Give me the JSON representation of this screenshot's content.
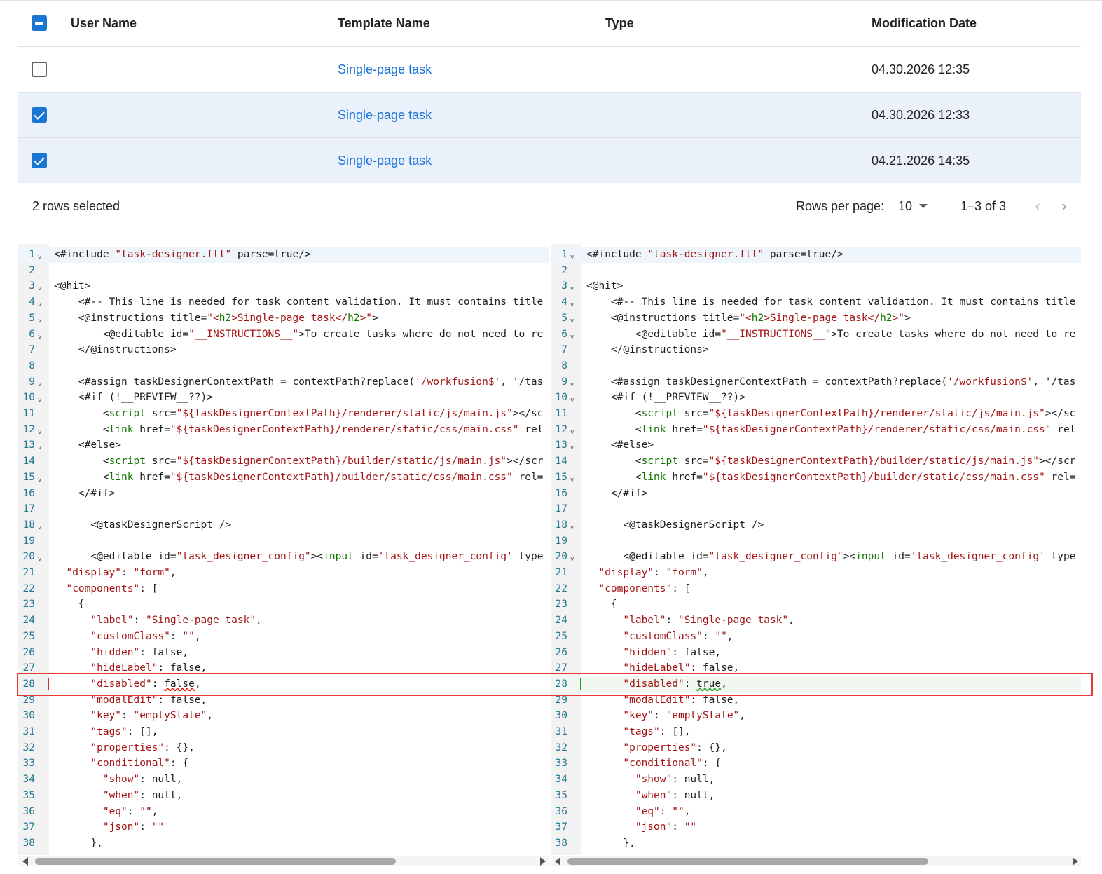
{
  "table": {
    "headers": [
      "User Name",
      "Template Name",
      "Type",
      "Modification Date"
    ],
    "rows": [
      {
        "user": "",
        "template": "Single-page task",
        "type": "",
        "date": "04.30.2026 12:35",
        "selected": false
      },
      {
        "user": "",
        "template": "Single-page task",
        "type": "",
        "date": "04.30.2026 12:33",
        "selected": true
      },
      {
        "user": "",
        "template": "Single-page task",
        "type": "",
        "date": "04.21.2026 14:35",
        "selected": true
      }
    ]
  },
  "footer": {
    "selected_text": "2 rows selected",
    "rows_per_page_label": "Rows per page:",
    "rows_per_page_value": "10",
    "range_text": "1–3 of 3"
  },
  "colors": {
    "accent": "#1976d2",
    "link": "#1a73d9",
    "removed": "#d32f2f",
    "added": "#2e9e2e"
  },
  "diff": {
    "changed_line": 28,
    "left_lines": [
      {
        "n": "1",
        "fold": true,
        "code": "<#include \"task-designer.ftl\" parse=true/>"
      },
      {
        "n": "2",
        "fold": false,
        "code": ""
      },
      {
        "n": "3",
        "fold": true,
        "code": "<@hit>"
      },
      {
        "n": "4",
        "fold": true,
        "code": "    <#-- This line is needed for task content validation. It must contains title"
      },
      {
        "n": "5",
        "fold": true,
        "code": "    <@instructions title=\"<h2>Single-page task</h2>\">"
      },
      {
        "n": "6",
        "fold": true,
        "code": "        <@editable id=\"__INSTRUCTIONS__\">To create tasks where do not need to re"
      },
      {
        "n": "7",
        "fold": false,
        "code": "    </@instructions>"
      },
      {
        "n": "8",
        "fold": false,
        "code": ""
      },
      {
        "n": "9",
        "fold": true,
        "code": "    <#assign taskDesignerContextPath = contextPath?replace('/workfusion$', '/tas"
      },
      {
        "n": "10",
        "fold": true,
        "code": "    <#if (!__PREVIEW__??)>"
      },
      {
        "n": "11",
        "fold": false,
        "code": "        <script src=\"${taskDesignerContextPath}/renderer/static/js/main.js\"></sc"
      },
      {
        "n": "12",
        "fold": true,
        "code": "        <link href=\"${taskDesignerContextPath}/renderer/static/css/main.css\" rel"
      },
      {
        "n": "13",
        "fold": true,
        "code": "    <#else>"
      },
      {
        "n": "14",
        "fold": false,
        "code": "        <script src=\"${taskDesignerContextPath}/builder/static/js/main.js\"></scr"
      },
      {
        "n": "15",
        "fold": true,
        "code": "        <link href=\"${taskDesignerContextPath}/builder/static/css/main.css\" rel="
      },
      {
        "n": "16",
        "fold": false,
        "code": "    </#if>"
      },
      {
        "n": "17",
        "fold": false,
        "code": ""
      },
      {
        "n": "18",
        "fold": true,
        "code": "      <@taskDesignerScript />"
      },
      {
        "n": "19",
        "fold": false,
        "code": ""
      },
      {
        "n": "20",
        "fold": true,
        "code": "      <@editable id=\"task_designer_config\"><input id='task_designer_config' type"
      },
      {
        "n": "21",
        "fold": false,
        "code": "  \"display\": \"form\","
      },
      {
        "n": "22",
        "fold": false,
        "code": "  \"components\": ["
      },
      {
        "n": "23",
        "fold": false,
        "code": "    {"
      },
      {
        "n": "24",
        "fold": false,
        "code": "      \"label\": \"Single-page task\","
      },
      {
        "n": "25",
        "fold": false,
        "code": "      \"customClass\": \"\","
      },
      {
        "n": "26",
        "fold": false,
        "code": "      \"hidden\": false,"
      },
      {
        "n": "27",
        "fold": false,
        "code": "      \"hideLabel\": false,"
      },
      {
        "n": "28",
        "fold": false,
        "code": "      \"disabled\": false,"
      },
      {
        "n": "29",
        "fold": false,
        "code": "      \"modalEdit\": false,"
      },
      {
        "n": "30",
        "fold": false,
        "code": "      \"key\": \"emptyState\","
      },
      {
        "n": "31",
        "fold": false,
        "code": "      \"tags\": [],"
      },
      {
        "n": "32",
        "fold": false,
        "code": "      \"properties\": {},"
      },
      {
        "n": "33",
        "fold": false,
        "code": "      \"conditional\": {"
      },
      {
        "n": "34",
        "fold": false,
        "code": "        \"show\": null,"
      },
      {
        "n": "35",
        "fold": false,
        "code": "        \"when\": null,"
      },
      {
        "n": "36",
        "fold": false,
        "code": "        \"eq\": \"\","
      },
      {
        "n": "37",
        "fold": false,
        "code": "        \"json\": \"\""
      },
      {
        "n": "38",
        "fold": false,
        "code": "      },"
      }
    ],
    "right_line_28": "      \"disabled\": true,"
  }
}
